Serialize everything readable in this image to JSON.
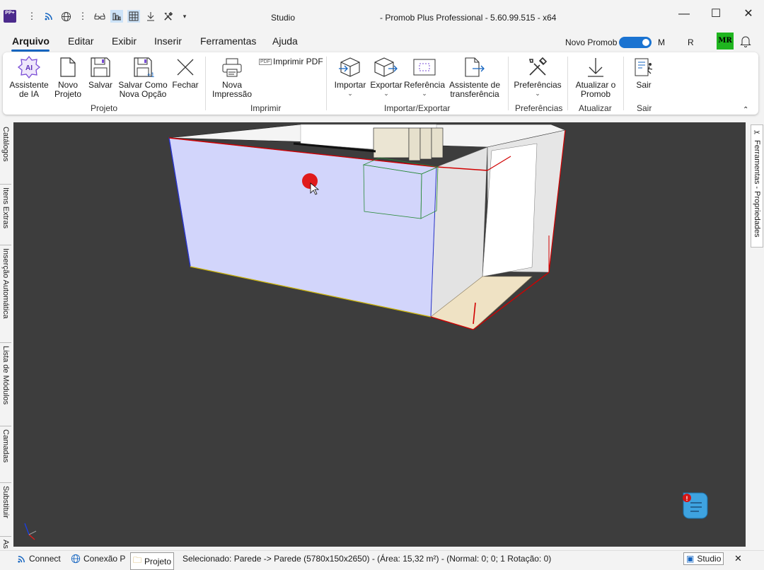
{
  "titlebar": {
    "app_logo": "PP+",
    "center_title": "Studio",
    "right_title": "- Promob Plus Professional - 5.60.99.515 - x64",
    "minimize": "—",
    "maximize": "☐",
    "close": "✕"
  },
  "menu": {
    "items": [
      "Arquivo",
      "Editar",
      "Exibir",
      "Inserir",
      "Ferramentas",
      "Ajuda"
    ],
    "novo_promob": "Novo Promob",
    "m": "M",
    "r": "R",
    "avatar": "MR"
  },
  "ribbon": {
    "assistente_ia": [
      "Assistente",
      "de IA"
    ],
    "novo_projeto": [
      "Novo",
      "Projeto"
    ],
    "salvar": "Salvar",
    "salvar_como": [
      "Salvar Como",
      "Nova Opção"
    ],
    "fechar": "Fechar",
    "group_projeto": "Projeto",
    "nova_impressao": [
      "Nova",
      "Impressão"
    ],
    "imprimir_pdf": "Imprimir PDF",
    "group_imprimir": "Imprimir",
    "importar": "Importar",
    "exportar": "Exportar",
    "referencia": "Referência",
    "assistente_transf": [
      "Assistente de",
      "transferência"
    ],
    "group_import_export": "Importar/Exportar",
    "preferencias": "Preferências",
    "group_preferencias": "Preferências",
    "atualizar": [
      "Atualizar o",
      "Promob"
    ],
    "group_atualizar": "Atualizar",
    "sair": "Sair",
    "group_sair": "Sair"
  },
  "left_tabs": [
    "Catálogos",
    "Itens Extras",
    "Inserção Automática",
    "Lista de Módulos",
    "Camadas",
    "Substituir",
    "As"
  ],
  "right_tab": "Ferramentas - Propriedades",
  "status": {
    "connect": "Connect",
    "conexao": "Conexão P",
    "projeto": "Projeto",
    "selection": "Selecionado: Parede -> Parede (5780x150x2650) - (Área: 15,32 m²) - (Normal: 0; 0; 1 Rotação: 0)",
    "studio": "Studio",
    "close": "✕"
  }
}
